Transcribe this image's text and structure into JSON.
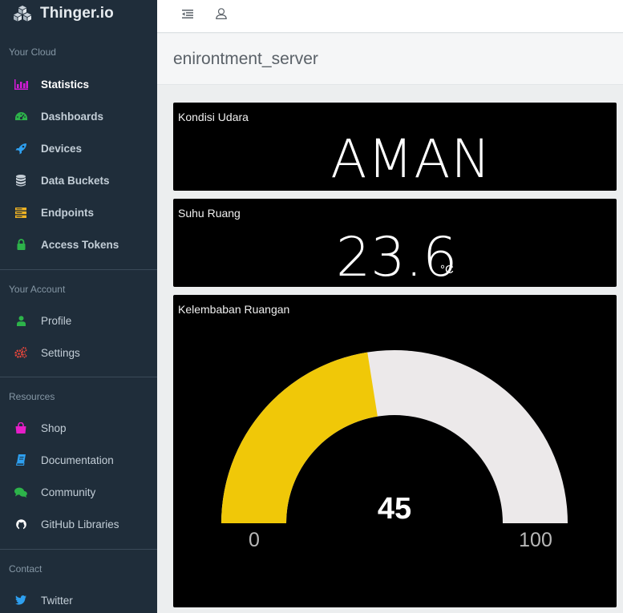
{
  "brand": {
    "name": "Thinger.io"
  },
  "sidebar": {
    "sections": [
      {
        "title": "Your Cloud",
        "items": [
          {
            "label": "Statistics",
            "icon": "bar-chart-icon",
            "color": "#d21bd6",
            "active": true
          },
          {
            "label": "Dashboards",
            "icon": "dashboard-gauge-icon",
            "color": "#2db34a"
          },
          {
            "label": "Devices",
            "icon": "rocket-icon",
            "color": "#2ea0f0"
          },
          {
            "label": "Data Buckets",
            "icon": "database-icon",
            "color": "#c5ced6"
          },
          {
            "label": "Endpoints",
            "icon": "server-icon",
            "color": "#f0b323"
          },
          {
            "label": "Access Tokens",
            "icon": "lock-icon",
            "color": "#2db34a"
          }
        ]
      },
      {
        "title": "Your Account",
        "items": [
          {
            "label": "Profile",
            "icon": "user-icon",
            "color": "#2db34a"
          },
          {
            "label": "Settings",
            "icon": "cogs-icon",
            "color": "#e8473c"
          }
        ]
      },
      {
        "title": "Resources",
        "items": [
          {
            "label": "Shop",
            "icon": "shopping-bag-icon",
            "color": "#e61ec8"
          },
          {
            "label": "Documentation",
            "icon": "book-icon",
            "color": "#2ea0f0"
          },
          {
            "label": "Community",
            "icon": "comments-icon",
            "color": "#2db34a"
          },
          {
            "label": "GitHub Libraries",
            "icon": "github-icon",
            "color": "#ffffff"
          }
        ]
      },
      {
        "title": "Contact",
        "items": [
          {
            "label": "Twitter",
            "icon": "twitter-icon",
            "color": "#2ea0f0"
          }
        ]
      }
    ]
  },
  "topbar": {
    "menu_icon": "menu-collapse-icon",
    "user_icon": "user-outline-icon"
  },
  "page": {
    "title": "enirontment_server"
  },
  "widgets": {
    "kondisi": {
      "title": "Kondisi Udara",
      "value": "AMAN"
    },
    "suhu": {
      "title": "Suhu Ruang",
      "value": "23.6",
      "unit": "°C"
    },
    "kelembaban": {
      "title": "Kelembaban Ruangan",
      "value": "45",
      "min_label": "0",
      "max_label": "100",
      "min": 0,
      "max": 100,
      "current": 45,
      "fill_color": "#f0c808",
      "track_color": "#ece9ea"
    }
  },
  "colors": {
    "sidebar_bg": "#1f2d3a",
    "widget_bg": "#000000"
  }
}
